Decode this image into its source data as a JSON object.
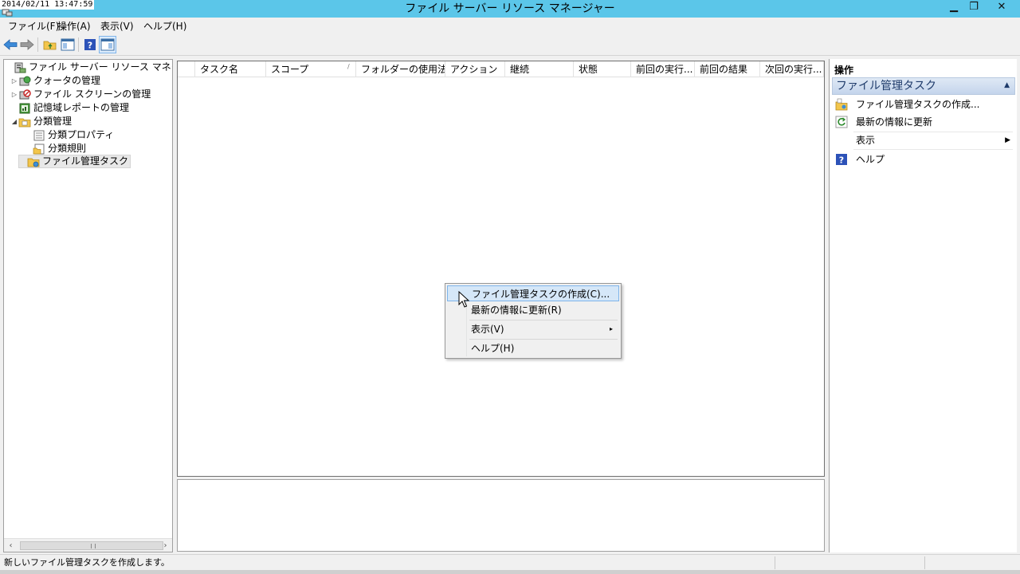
{
  "timestamp": "2014/02/11 13:47:59",
  "window": {
    "title": "ファイル サーバー リソース マネージャー",
    "min_glyph": "▁",
    "max_glyph": "❐",
    "close_glyph": "✕"
  },
  "menubar": {
    "items": [
      "ファイル(F)",
      "操作(A)",
      "表示(V)",
      "ヘルプ(H)"
    ]
  },
  "toolbar": {
    "icons": [
      "back-arrow-icon",
      "forward-arrow-icon",
      "up-folder-icon",
      "show-hide-tree-icon",
      "help-icon",
      "show-hide-action-pane-icon"
    ]
  },
  "tree": {
    "items": [
      {
        "label": "ファイル サーバー リソース マネージャー (ロ-",
        "icon": "server-icon",
        "expander": ""
      },
      {
        "label": "クォータの管理",
        "icon": "quota-icon",
        "expander": "▷"
      },
      {
        "label": "ファイル スクリーンの管理",
        "icon": "file-screen-icon",
        "expander": "▷"
      },
      {
        "label": "記憶域レポートの管理",
        "icon": "report-icon",
        "expander": ""
      },
      {
        "label": "分類管理",
        "icon": "classification-folder-icon",
        "expander": "◢"
      },
      {
        "label": "分類プロパティ",
        "icon": "property-icon",
        "expander": ""
      },
      {
        "label": "分類規則",
        "icon": "rule-icon",
        "expander": ""
      },
      {
        "label": "ファイル管理タスク",
        "icon": "task-folder-icon",
        "expander": "",
        "selected": true
      }
    ],
    "scroll_left": "‹",
    "scroll_right": "›"
  },
  "list": {
    "columns": [
      "",
      "タスク名",
      "スコープ",
      "フォルダーの使用法",
      "アクション",
      "継続",
      "状態",
      "前回の実行...",
      "前回の結果",
      "次回の実行..."
    ],
    "sort_indicator": "/"
  },
  "actions": {
    "title": "操作",
    "section": "ファイル管理タスク",
    "collapse_glyph": "▲",
    "items": [
      {
        "label": "ファイル管理タスクの作成...",
        "icon": "create-task-icon"
      },
      {
        "label": "最新の情報に更新",
        "icon": "refresh-icon"
      },
      {
        "label": "表示",
        "icon": "",
        "submenu": "▶"
      },
      {
        "label": "ヘルプ",
        "icon": "help-icon"
      }
    ]
  },
  "context_menu": {
    "items": [
      {
        "label": "ファイル管理タスクの作成(C)...",
        "highlighted": true
      },
      {
        "label": "最新の情報に更新(R)"
      },
      {
        "label": "表示(V)",
        "submenu": "▸"
      },
      {
        "label": "ヘルプ(H)"
      }
    ]
  },
  "status": {
    "text": "新しいファイル管理タスクを作成します。"
  },
  "colors": {
    "titlebar": "#5bc6e9",
    "selection": "#d5e7f8",
    "section_header": "#c4d5ec"
  }
}
